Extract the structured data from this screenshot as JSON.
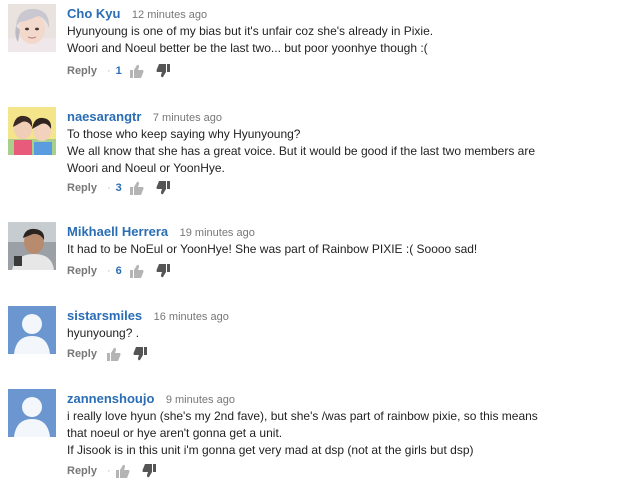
{
  "comments": [
    {
      "author": "Cho Kyu",
      "time": "12 minutes ago",
      "lines": [
        "Hyunyoung is one of my bias but it's unfair coz she's already in Pixie.",
        "Woori and Noeul better be the last two... but poor yoonhye though :("
      ],
      "reply_label": "Reply",
      "score_separator": "·",
      "score": "1",
      "avatar": "photo-portrait-blonde"
    },
    {
      "author": "naesarangtr",
      "time": "7 minutes ago",
      "lines": [
        "To those who keep saying why Hyunyoung?",
        "We all know that she has a great voice. But it would be good if the last two members are",
        "Woori and Noeul or YoonHye."
      ],
      "reply_label": "Reply",
      "score_separator": "·",
      "score": "3",
      "avatar": "photo-two-people"
    },
    {
      "author": "Mikhaell Herrera",
      "time": "19 minutes ago",
      "lines": [
        "It had to be NoEul or YoonHye! She was part of Rainbow PIXIE :( Soooo sad!"
      ],
      "reply_label": "Reply",
      "score_separator": "·",
      "score": "6",
      "avatar": "photo-selfie"
    },
    {
      "author": "sistarsmiles",
      "time": "16 minutes ago",
      "lines": [
        "hyunyoung? ."
      ],
      "reply_label": "Reply",
      "score_separator": "",
      "score": "",
      "avatar": "default-user"
    },
    {
      "author": "zannenshoujo",
      "time": "9 minutes ago",
      "lines": [
        "i really love hyun (she's my 2nd fave), but she's /was part of rainbow pixie, so this means",
        "that noeul or hye aren't gonna get a unit.",
        "If Jisook is in this unit i'm gonna get very mad at dsp (not at the girls but dsp)"
      ],
      "reply_label": "Reply",
      "score_separator": "·",
      "score": "",
      "avatar": "default-user"
    }
  ],
  "colors": {
    "author": "#2a6db5",
    "time": "#777777",
    "text": "#222222",
    "action_icon": "#b4b4b4",
    "default_avatar_bg": "#6b96cf"
  }
}
